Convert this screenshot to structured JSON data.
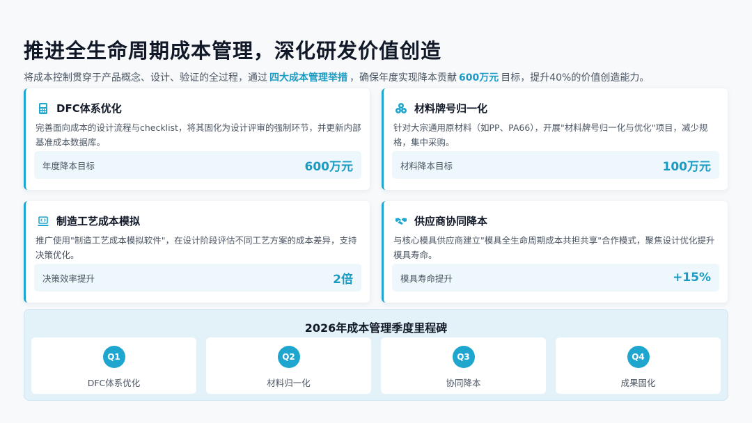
{
  "header": {
    "title": "推进全生命周期成本管理，深化研发价值创造",
    "subtitle_part1": "将成本控制贯穿于产品概念、设计、验证的全过程，通过",
    "subtitle_highlight1": "四大成本管理举措",
    "subtitle_part2": "，确保年度实现降本贡献",
    "subtitle_highlight2": "600万元",
    "subtitle_part3": "目标，提升40%的价值创造能力。"
  },
  "cards": [
    {
      "icon": "calculator-icon",
      "title": "DFC体系优化",
      "desc": "完善面向成本的设计流程与checklist，将其固化为设计评审的强制环节，并更新内部基准成本数据库。",
      "metric_label": "年度降本目标",
      "metric_value": "600万元"
    },
    {
      "icon": "cubes-icon",
      "title": "材料牌号归一化",
      "desc": "针对大宗通用原材料（如PP、PA66），开展\"材料牌号归一化与优化\"项目，减少规格，集中采购。",
      "metric_label": "材料降本目标",
      "metric_value": "100万元"
    },
    {
      "icon": "laptop-code-icon",
      "title": "制造工艺成本模拟",
      "desc": "推广使用\"制造工艺成本模拟软件\"，在设计阶段评估不同工艺方案的成本差异，支持决策优化。",
      "metric_label": "决策效率提升",
      "metric_value": "2倍"
    },
    {
      "icon": "handshake-icon",
      "title": "供应商协同降本",
      "desc": "与核心模具供应商建立\"模具全生命周期成本共担共享\"合作模式，聚焦设计优化提升模具寿命。",
      "metric_label": "模具寿命提升",
      "metric_value": "+15%"
    }
  ],
  "roadmap": {
    "title": "2026年成本管理季度里程碑",
    "quarters": [
      {
        "badge": "Q1",
        "label": "DFC体系优化"
      },
      {
        "badge": "Q2",
        "label": "材料归一化"
      },
      {
        "badge": "Q3",
        "label": "协同降本"
      },
      {
        "badge": "Q4",
        "label": "成果固化"
      }
    ]
  },
  "colors": {
    "accent": "#1fa6cf",
    "highlight_text": "#1a9bc4",
    "metric_bg": "#eef7fb",
    "roadmap_bg": "#e3f1f8"
  }
}
